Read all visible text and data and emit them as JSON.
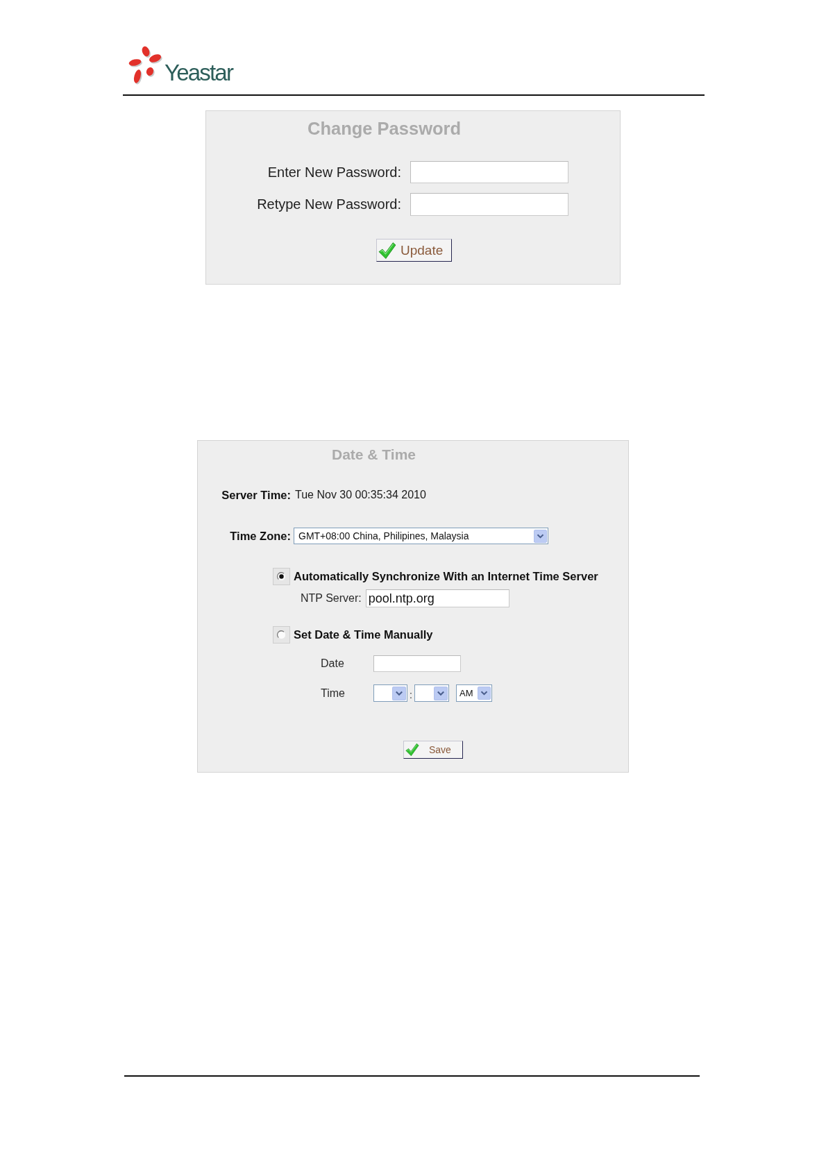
{
  "header": {
    "logo_text": "Yeastar"
  },
  "change_password": {
    "title": "Change Password",
    "fields": [
      {
        "label": "Enter New Password:"
      },
      {
        "label": "Retype New Password:"
      }
    ],
    "button": "Update"
  },
  "date_time": {
    "title": "Date & Time",
    "server_time": {
      "label": "Server Time:",
      "value": "Tue Nov 30 00:35:34 2010"
    },
    "time_zone": {
      "label": "Time Zone:",
      "value": "GMT+08:00 China, Philipines, Malaysia"
    },
    "options": [
      {
        "kind": "ntp",
        "label": "Automatically Synchronize With an Internet Time Server",
        "selected": true,
        "ntp_server": {
          "label": "NTP Server:",
          "value": "pool.ntp.org"
        }
      },
      {
        "kind": "manual",
        "label": "Set Date & Time Manually",
        "selected": false,
        "date": {
          "label": "Date"
        },
        "time": {
          "label": "Time",
          "separator": ":",
          "period": "AM"
        }
      }
    ],
    "button": "Save"
  }
}
